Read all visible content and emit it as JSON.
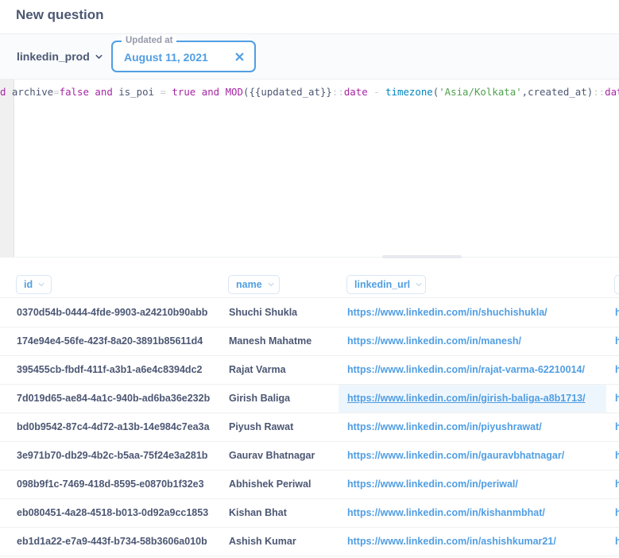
{
  "header": {
    "title": "New question"
  },
  "filterbar": {
    "database": "linkedin_prod",
    "variable": {
      "label": "Updated at",
      "value": "August 11, 2021"
    }
  },
  "editor": {
    "tokens": [
      {
        "t": "kw",
        "v": "d"
      },
      {
        "t": "plain",
        "v": " archive"
      },
      {
        "t": "op",
        "v": "="
      },
      {
        "t": "kw",
        "v": "false"
      },
      {
        "t": "plain",
        "v": " "
      },
      {
        "t": "kw",
        "v": "and"
      },
      {
        "t": "plain",
        "v": " is_poi "
      },
      {
        "t": "op",
        "v": "="
      },
      {
        "t": "plain",
        "v": " "
      },
      {
        "t": "kw",
        "v": "true"
      },
      {
        "t": "plain",
        "v": " "
      },
      {
        "t": "kw",
        "v": "and"
      },
      {
        "t": "plain",
        "v": " "
      },
      {
        "t": "kw",
        "v": "MOD"
      },
      {
        "t": "plain",
        "v": "({{updated_at}}"
      },
      {
        "t": "op",
        "v": "::"
      },
      {
        "t": "kw",
        "v": "date"
      },
      {
        "t": "plain",
        "v": " "
      },
      {
        "t": "op",
        "v": "-"
      },
      {
        "t": "plain",
        "v": " "
      },
      {
        "t": "fn",
        "v": "timezone"
      },
      {
        "t": "plain",
        "v": "("
      },
      {
        "t": "str",
        "v": "'Asia/Kolkata'"
      },
      {
        "t": "plain",
        "v": ",created_at)"
      },
      {
        "t": "op",
        "v": "::"
      },
      {
        "t": "kw",
        "v": "date"
      }
    ]
  },
  "table": {
    "columns": [
      "id",
      "name",
      "linkedin_url",
      "h"
    ],
    "rows": [
      {
        "id": "0370d54b-0444-4fde-9903-a24210b90abb",
        "name": "Shuchi Shukla",
        "url": "https://www.linkedin.com/in/shuchishukla/",
        "extra": "h"
      },
      {
        "id": "174e94e4-56fe-423f-8a20-3891b85611d4",
        "name": "Manesh Mahatme",
        "url": "https://www.linkedin.com/in/manesh/",
        "extra": "h"
      },
      {
        "id": "395455cb-fbdf-411f-a3b1-a6e4c8394dc2",
        "name": "Rajat Varma",
        "url": "https://www.linkedin.com/in/rajat-varma-62210014/",
        "extra": "h"
      },
      {
        "id": "7d019d65-ae84-4a1c-940b-ad6ba36e232b",
        "name": "Girish Baliga",
        "url": "https://www.linkedin.com/in/girish-baliga-a8b1713/",
        "extra": "h"
      },
      {
        "id": "bd0b9542-87c4-4d72-a13b-14e984c7ea3a",
        "name": "Piyush Rawat",
        "url": "https://www.linkedin.com/in/piyushrawat/",
        "extra": "h"
      },
      {
        "id": "3e971b70-db29-4b2c-b5aa-75f24e3a281b",
        "name": "Gaurav Bhatnagar",
        "url": "https://www.linkedin.com/in/gauravbhatnagar/",
        "extra": "h"
      },
      {
        "id": "098b9f1c-7469-418d-8595-e0870b1f32e3",
        "name": "Abhishek Periwal",
        "url": "https://www.linkedin.com/in/periwal/",
        "extra": "h"
      },
      {
        "id": "eb080451-4a28-4518-b013-0d92a9cc1853",
        "name": "Kishan Bhat",
        "url": "https://www.linkedin.com/in/kishanmbhat/",
        "extra": "h"
      },
      {
        "id": "eb1d1a22-e7a9-443f-b734-58b3606a010b",
        "name": "Ashish Kumar",
        "url": "https://www.linkedin.com/in/ashishkumar21/",
        "extra": "h"
      }
    ],
    "hovered_row": 3
  },
  "colors": {
    "brand": "#509ee3",
    "text": "#4c5773"
  },
  "icons": {
    "db_chevron": "chevron-down-icon",
    "clear": "close-icon",
    "column_chevron": "chevron-down-icon"
  }
}
